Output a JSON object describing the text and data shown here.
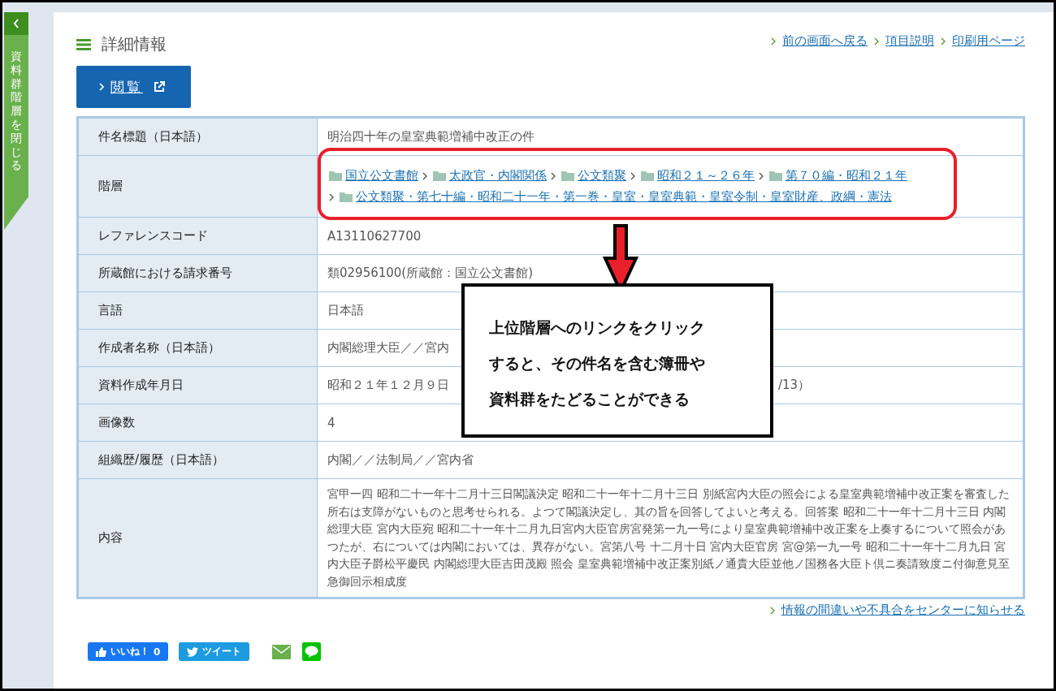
{
  "sidebar": {
    "label": "資料群階層を閉じる"
  },
  "header": {
    "title": "詳細情報",
    "links": [
      "前の画面へ戻る",
      "項目説明",
      "印刷用ページ"
    ]
  },
  "view_button": {
    "label": "閲覧"
  },
  "details": [
    {
      "kind": "text",
      "label": "件名標題（日本語）",
      "value": "明治四十年の皇室典範増補中改正の件"
    },
    {
      "kind": "breadcrumb",
      "label": "階層",
      "items": [
        "国立公文書館",
        "太政官・内閣関係",
        "公文類聚",
        "昭和２１～２６年",
        "第７０編・昭和２１年",
        "公文類聚・第七十編・昭和二十一年・第一巻・皇室・皇室典範・皇室令制・皇室財産、政綱・憲法"
      ]
    },
    {
      "kind": "text",
      "label": "レファレンスコード",
      "value": "A13110627700"
    },
    {
      "kind": "text",
      "label": "所蔵館における請求番号",
      "value": "類02956100(所蔵館：国立公文書館)"
    },
    {
      "kind": "text",
      "label": "言語",
      "value": "日本語"
    },
    {
      "kind": "text",
      "label": "作成者名称（日本語）",
      "value": "内閣総理大臣／／宮内"
    },
    {
      "kind": "split",
      "label": "資料作成年月日",
      "parts": [
        "昭和２１年１２月９日",
        "/13）"
      ]
    },
    {
      "kind": "text",
      "label": "画像数",
      "value": "4"
    },
    {
      "kind": "text",
      "label": "組織歴/履歴（日本語）",
      "value": "内閣／／法制局／／宮内省"
    },
    {
      "kind": "long",
      "label": "内容",
      "value": "宮甲一四 昭和二十一年十二月十三日閣議決定 昭和二十一年十二月十三日 別紙宮内大臣の照会による皇室典範増補中改正案を審査した所右は支障がないものと思考せられる。よつて閣議決定し、其の旨を回答してよいと考える。回答案 昭和二十一年十二月十三日 内閣総理大臣 宮内大臣宛 昭和二十一年十二月九日宮内大臣官房宮発第一九一号により皇室典範増補中改正案を上奏するについて照会があつたが、右については内閣においては、異存がない。宮第八号 十二月十日 宮内大臣官房 宮@第一九一号 昭和二十一年十二月九日 宮内大臣子爵松平慶民 内閣総理大臣吉田茂殿 照会 皇室典範増補中改正案別紙ノ通貴大臣並他ノ国務各大臣ト倶ニ奏請致度ニ付御意見至急御回示相成度"
    }
  ],
  "annotation": {
    "text": "上位階層へのリンクをクリックすると、その件名を含む簿冊や資料群をたどることができる"
  },
  "report_link": "情報の間違いや不具合をセンターに知らせる",
  "social": {
    "like_label": "いいね！",
    "like_count": "0",
    "tweet_label": "ツイート"
  }
}
